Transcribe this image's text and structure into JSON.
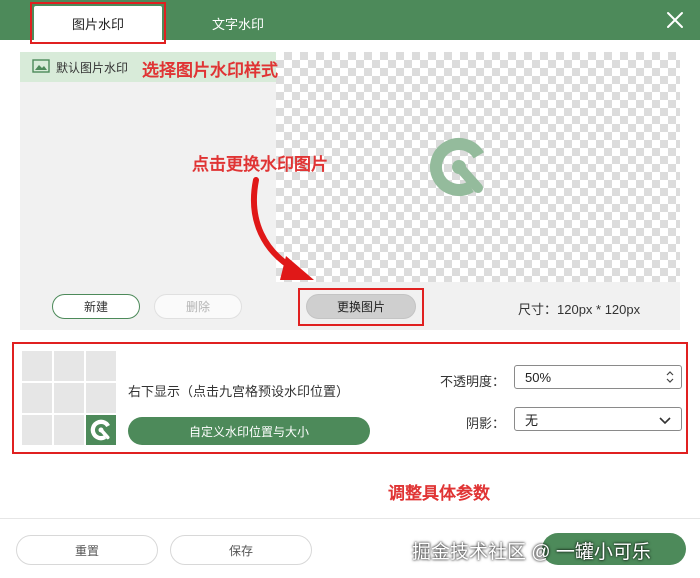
{
  "tabs": {
    "image_watermark": "图片水印",
    "text_watermark": "文字水印"
  },
  "preview": {
    "default_style_label": "默认图片水印",
    "new_button": "新建",
    "delete_button": "删除",
    "change_image_button": "更换图片",
    "size_text": "尺寸：120px * 120px"
  },
  "annotations": {
    "select_style": "选择图片水印样式",
    "change_image": "点击更换水印图片",
    "adjust_params": "调整具体参数"
  },
  "settings": {
    "position_text": "右下显示（点击九宫格预设水印位置）",
    "custom_position_button": "自定义水印位置与大小",
    "opacity_label": "不透明度：",
    "opacity_value": "50%",
    "shadow_label": "阴影：",
    "shadow_value": "无",
    "selected_cell": 8
  },
  "footer": {
    "reset_button": "重置",
    "save_button": "保存",
    "watermark_text": "掘金技术社区 @ 一罐小可乐"
  },
  "colors": {
    "brand_green": "#4d8a5a",
    "annotation_red": "#e03434",
    "highlight_box": "#e02020"
  },
  "icons": {
    "close": "close-icon",
    "image": "image-icon",
    "logo": "brand-logo-icon",
    "spinner": "spinner-arrows-icon",
    "chevron": "chevron-down-icon",
    "arrow": "red-curved-arrow"
  }
}
